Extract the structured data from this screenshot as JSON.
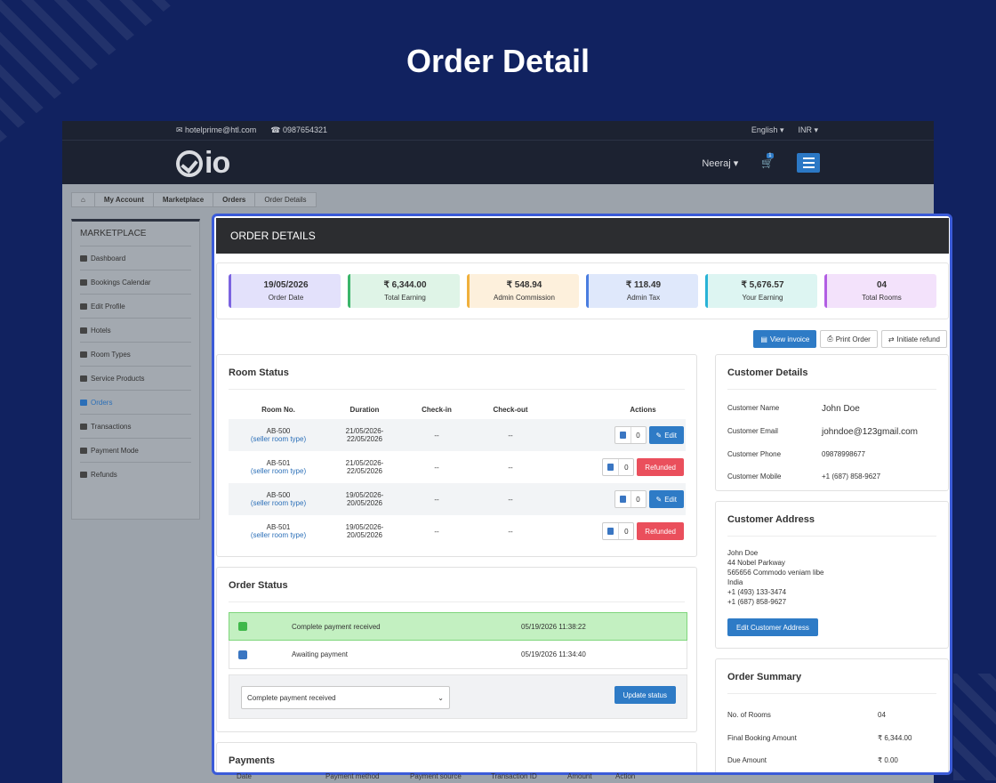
{
  "hero": {
    "title": "Order Detail"
  },
  "topbar": {
    "email": "hotelprime@htl.com",
    "phone": "0987654321",
    "language": "English ▾",
    "currency": "INR ▾"
  },
  "navbar": {
    "logo_text": "io",
    "user": "Neeraj ▾",
    "cart_count": "1"
  },
  "breadcrumb": [
    "My Account",
    "Marketplace",
    "Orders",
    "Order Details"
  ],
  "sidebar": {
    "title": "MARKETPLACE",
    "items": [
      {
        "label": "Dashboard",
        "icon": "dashboard-icon"
      },
      {
        "label": "Bookings Calendar",
        "icon": "bar-chart-icon"
      },
      {
        "label": "Edit Profile",
        "icon": "user-icon"
      },
      {
        "label": "Hotels",
        "icon": "building-icon"
      },
      {
        "label": "Room Types",
        "icon": "bed-icon"
      },
      {
        "label": "Service Products",
        "icon": "user-plus-icon"
      },
      {
        "label": "Orders",
        "icon": "credit-card-icon"
      },
      {
        "label": "Transactions",
        "icon": "money-icon"
      },
      {
        "label": "Payment Mode",
        "icon": "money-icon"
      },
      {
        "label": "Refunds",
        "icon": "undo-icon"
      }
    ]
  },
  "order": {
    "header": "ORDER DETAILS",
    "stats": [
      {
        "value": "19/05/2026",
        "label": "Order Date",
        "bg": "#e3e1fb",
        "accent": "#7b63e0"
      },
      {
        "value": "₹ 6,344.00",
        "label": "Total Earning",
        "bg": "#dff4e7",
        "accent": "#3bb56a"
      },
      {
        "value": "₹ 548.94",
        "label": "Admin Commission",
        "bg": "#fdf0dc",
        "accent": "#f0b03c"
      },
      {
        "value": "₹ 118.49",
        "label": "Admin Tax",
        "bg": "#dfe8fb",
        "accent": "#4a7de0"
      },
      {
        "value": "₹ 5,676.57",
        "label": "Your Earning",
        "bg": "#ddf5f2",
        "accent": "#29b3d6"
      },
      {
        "value": "04",
        "label": "Total Rooms",
        "bg": "#f3e2fb",
        "accent": "#b25ee3"
      }
    ],
    "buttons": {
      "view_invoice": "View invoice",
      "print_order": "Print Order",
      "initiate_refund": "Initiate refund"
    }
  },
  "room_status": {
    "title": "Room Status",
    "columns": [
      "Room No.",
      "Duration",
      "Check-in",
      "Check-out",
      "Actions"
    ],
    "rows": [
      {
        "room": "AB-500",
        "type": "(seller room type)",
        "dur1": "21/05/2026-",
        "dur2": "22/05/2026",
        "checkin": "--",
        "checkout": "--",
        "count": "0",
        "action": "Edit",
        "kind": "edit"
      },
      {
        "room": "AB-501",
        "type": "(seller room type)",
        "dur1": "21/05/2026-",
        "dur2": "22/05/2026",
        "checkin": "--",
        "checkout": "--",
        "count": "0",
        "action": "Refunded",
        "kind": "refunded"
      },
      {
        "room": "AB-500",
        "type": "(seller room type)",
        "dur1": "19/05/2026-",
        "dur2": "20/05/2026",
        "checkin": "--",
        "checkout": "--",
        "count": "0",
        "action": "Edit",
        "kind": "edit"
      },
      {
        "room": "AB-501",
        "type": "(seller room type)",
        "dur1": "19/05/2026-",
        "dur2": "20/05/2026",
        "checkin": "--",
        "checkout": "--",
        "count": "0",
        "action": "Refunded",
        "kind": "refunded"
      }
    ]
  },
  "order_status": {
    "title": "Order Status",
    "rows": [
      {
        "label": "Complete payment received",
        "time": "05/19/2026 11:38:22",
        "color": "#3fb84a"
      },
      {
        "label": "Awaiting payment",
        "time": "05/19/2026 11:34:40",
        "color": "#3a76c2"
      }
    ],
    "select_value": "Complete payment received",
    "update_button": "Update status"
  },
  "payments": {
    "title": "Payments",
    "columns": [
      "Date",
      "Payment method",
      "Payment source",
      "Transaction ID",
      "Amount",
      "Action"
    ]
  },
  "customer": {
    "title": "Customer Details",
    "fields": [
      {
        "k": "Customer Name",
        "v": "John Doe"
      },
      {
        "k": "Customer Email",
        "v": "johndoe@123gmail.com"
      },
      {
        "k": "Customer Phone",
        "v": "09878998677"
      },
      {
        "k": "Customer Mobile",
        "v": "+1 (687) 858-9627"
      }
    ]
  },
  "address": {
    "title": "Customer Address",
    "lines": [
      "John Doe",
      "44 Nobel Parkway",
      "565656 Commodo veniam libe",
      "India",
      "+1 (493) 133-3474",
      "+1 (687) 858-9627"
    ],
    "button": "Edit Customer Address"
  },
  "summary": {
    "title": "Order Summary",
    "fields": [
      {
        "k": "No. of Rooms",
        "v": "04"
      },
      {
        "k": "Final Booking Amount",
        "v": "₹ 6,344.00"
      },
      {
        "k": "Due Amount",
        "v": "₹ 0.00"
      }
    ]
  }
}
